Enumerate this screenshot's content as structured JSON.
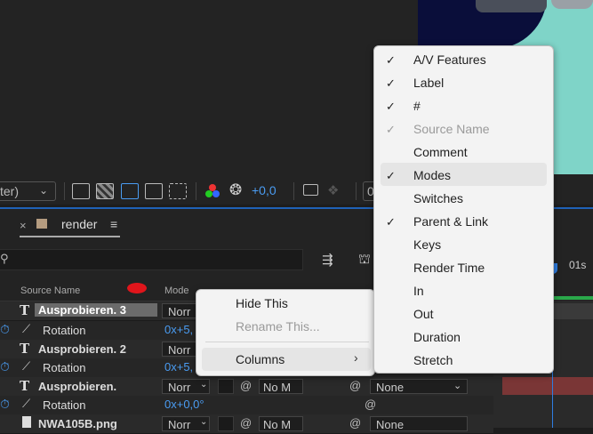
{
  "viewer": {
    "resolution_label": "ter)",
    "exposure_value": "+0,0",
    "timecode_partial": "0"
  },
  "timeline": {
    "tab": {
      "close_label": "×",
      "label": "render",
      "menu_label": "≡"
    },
    "search_placeholder": "",
    "columns": {
      "source_name": "Source Name",
      "mode": "Mode"
    },
    "ruler_label": "01s",
    "rows": [
      {
        "kind": "layer",
        "name": "Ausprobieren. 3",
        "mode": "Norr",
        "selected": true
      },
      {
        "kind": "property",
        "name": "Rotation",
        "value": "0x+5,"
      },
      {
        "kind": "layer",
        "name": "Ausprobieren. 2",
        "mode": "Norr"
      },
      {
        "kind": "property",
        "name": "Rotation",
        "value": "0x+5,"
      },
      {
        "kind": "layer",
        "name": "Ausprobieren.",
        "mode": "Norr",
        "trkmat": "No M",
        "parent": "None"
      },
      {
        "kind": "property",
        "name": "Rotation",
        "value": "0x+0,0°"
      },
      {
        "kind": "layer",
        "name": "NWA105B.png",
        "mode": "Norr",
        "trkmat": "No M",
        "parent": "None"
      }
    ]
  },
  "context_menu": {
    "items": [
      {
        "label": "Hide This",
        "enabled": true
      },
      {
        "label": "Rename This...",
        "enabled": false
      },
      {
        "label": "Columns",
        "enabled": true,
        "submenu": true,
        "arrow": "›"
      }
    ]
  },
  "columns_submenu": {
    "items": [
      {
        "label": "A/V Features",
        "checked": true,
        "enabled": true
      },
      {
        "label": "Label",
        "checked": true,
        "enabled": true
      },
      {
        "label": "#",
        "checked": true,
        "enabled": true
      },
      {
        "label": "Source Name",
        "checked": true,
        "enabled": false
      },
      {
        "label": "Comment",
        "checked": false,
        "enabled": true
      },
      {
        "label": "Modes",
        "checked": true,
        "enabled": true,
        "hovered": true
      },
      {
        "label": "Switches",
        "checked": false,
        "enabled": true
      },
      {
        "label": "Parent & Link",
        "checked": true,
        "enabled": true
      },
      {
        "label": "Keys",
        "checked": false,
        "enabled": true
      },
      {
        "label": "Render Time",
        "checked": false,
        "enabled": true
      },
      {
        "label": "In",
        "checked": false,
        "enabled": true
      },
      {
        "label": "Out",
        "checked": false,
        "enabled": true
      },
      {
        "label": "Duration",
        "checked": false,
        "enabled": true
      },
      {
        "label": "Stretch",
        "checked": false,
        "enabled": true
      }
    ],
    "check_glyph": "✓"
  },
  "colors": {
    "accent_blue": "#2f7de1",
    "label_red": "#e0151b",
    "track_green": "#2aa84a"
  }
}
